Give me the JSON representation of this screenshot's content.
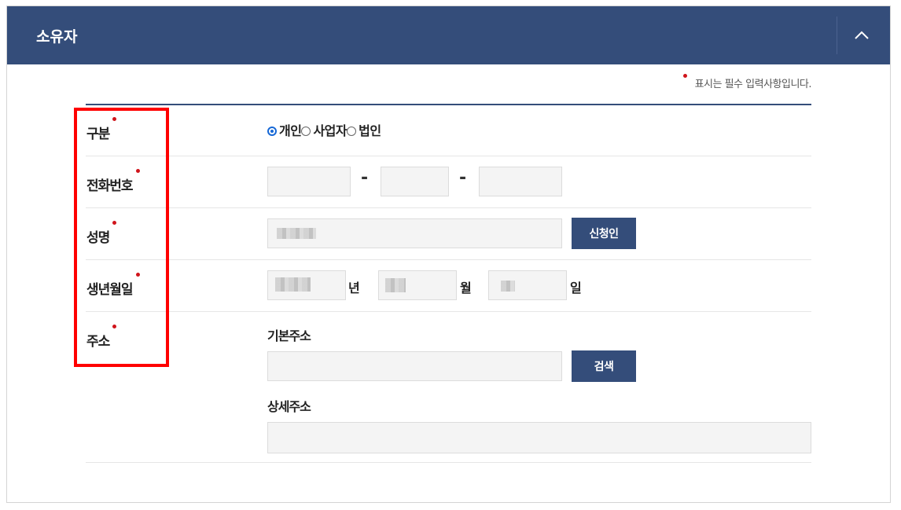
{
  "header": {
    "title": "소유자",
    "collapse_icon": "chevron-up-icon"
  },
  "required_note": "표시는 필수 입력사항입니다.",
  "rows": {
    "type": {
      "label": "구분",
      "options": [
        {
          "label": "개인",
          "checked": true
        },
        {
          "label": "사업자",
          "checked": false
        },
        {
          "label": "법인",
          "checked": false
        }
      ]
    },
    "phone": {
      "label": "전화번호",
      "separator": "-",
      "part1": "",
      "part2": "",
      "part3": ""
    },
    "name": {
      "label": "성명",
      "value": "",
      "button": "신청인"
    },
    "birth": {
      "label": "생년월일",
      "year_unit": "년",
      "month_unit": "월",
      "day_unit": "일"
    },
    "address": {
      "label": "주소",
      "basic_label": "기본주소",
      "search_button": "검색",
      "detail_label": "상세주소"
    }
  },
  "colors": {
    "accent": "#344d7a",
    "required": "#d0141b",
    "highlight": "#ff0000"
  }
}
